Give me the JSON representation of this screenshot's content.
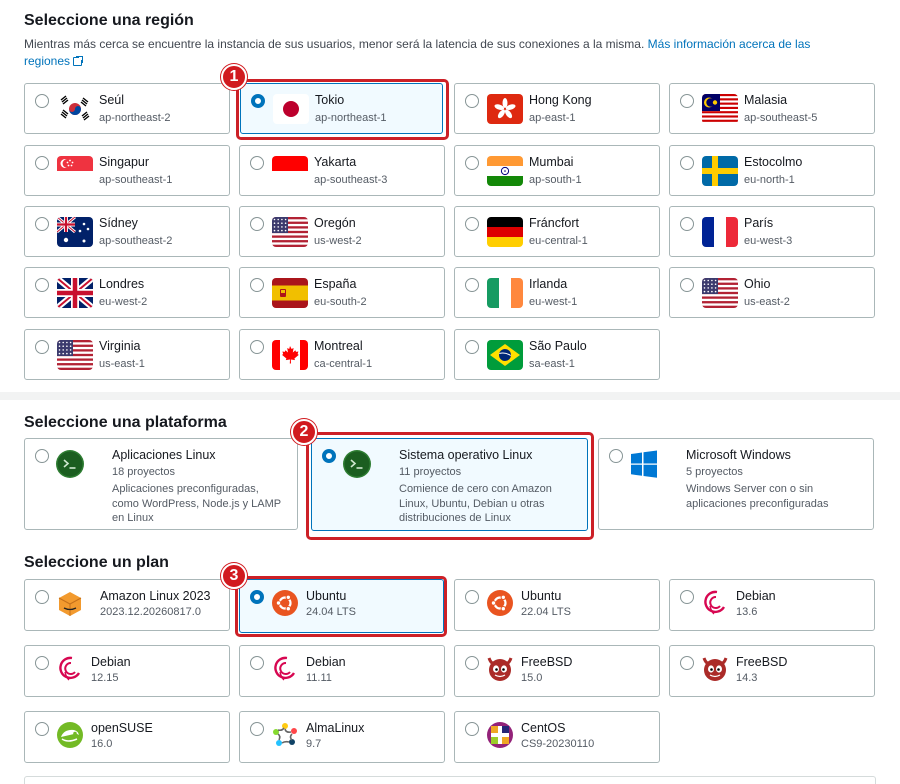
{
  "region_section": {
    "title": "Seleccione una región",
    "description": "Mientras más cerca se encuentre la instancia de sus usuarios, menor será la latencia de sus conexiones a la misma.",
    "link": "Más información acerca de las regiones",
    "regions": [
      {
        "name": "Seúl",
        "code": "ap-northeast-2",
        "flag": "south-korea-flag",
        "selected": false
      },
      {
        "name": "Tokio",
        "code": "ap-northeast-1",
        "flag": "japan-flag",
        "selected": true
      },
      {
        "name": "Hong Kong",
        "code": "ap-east-1",
        "flag": "hong-kong-flag",
        "selected": false
      },
      {
        "name": "Malasia",
        "code": "ap-southeast-5",
        "flag": "malaysia-flag",
        "selected": false
      },
      {
        "name": "Singapur",
        "code": "ap-southeast-1",
        "flag": "singapore-flag",
        "selected": false
      },
      {
        "name": "Yakarta",
        "code": "ap-southeast-3",
        "flag": "indonesia-flag",
        "selected": false
      },
      {
        "name": "Mumbai",
        "code": "ap-south-1",
        "flag": "india-flag",
        "selected": false
      },
      {
        "name": "Estocolmo",
        "code": "eu-north-1",
        "flag": "sweden-flag",
        "selected": false
      },
      {
        "name": "Sídney",
        "code": "ap-southeast-2",
        "flag": "australia-flag",
        "selected": false
      },
      {
        "name": "Oregón",
        "code": "us-west-2",
        "flag": "usa-flag",
        "selected": false
      },
      {
        "name": "Fráncfort",
        "code": "eu-central-1",
        "flag": "germany-flag",
        "selected": false
      },
      {
        "name": "París",
        "code": "eu-west-3",
        "flag": "france-flag",
        "selected": false
      },
      {
        "name": "Londres",
        "code": "eu-west-2",
        "flag": "uk-flag",
        "selected": false
      },
      {
        "name": "España",
        "code": "eu-south-2",
        "flag": "spain-flag",
        "selected": false
      },
      {
        "name": "Irlanda",
        "code": "eu-west-1",
        "flag": "ireland-flag",
        "selected": false
      },
      {
        "name": "Ohio",
        "code": "us-east-2",
        "flag": "usa-flag",
        "selected": false
      },
      {
        "name": "Virginia",
        "code": "us-east-1",
        "flag": "usa-flag",
        "selected": false
      },
      {
        "name": "Montreal",
        "code": "ca-central-1",
        "flag": "canada-flag",
        "selected": false
      },
      {
        "name": "São Paulo",
        "code": "sa-east-1",
        "flag": "brazil-flag",
        "selected": false
      }
    ]
  },
  "platform_section": {
    "title": "Seleccione una plataforma",
    "platforms": [
      {
        "name": "Aplicaciones Linux",
        "count": "18 proyectos",
        "description": "Aplicaciones preconfiguradas, como WordPress, Node.js y LAMP en Linux",
        "icon": "terminal-icon",
        "selected": false
      },
      {
        "name": "Sistema operativo Linux",
        "count": "11 proyectos",
        "description": "Comience de cero con Amazon Linux, Ubuntu, Debian u otras distribuciones de Linux",
        "icon": "terminal-icon",
        "selected": true
      },
      {
        "name": "Microsoft Windows",
        "count": "5 proyectos",
        "description": "Windows Server con o sin aplicaciones preconfiguradas",
        "icon": "windows-icon",
        "selected": false
      }
    ]
  },
  "plan_section": {
    "title": "Seleccione un plan",
    "plans": [
      {
        "name": "Amazon Linux 2023",
        "version": "2023.12.20260817.0",
        "icon": "amazon-linux-icon",
        "selected": false
      },
      {
        "name": "Ubuntu",
        "version": "24.04 LTS",
        "icon": "ubuntu-icon",
        "selected": true
      },
      {
        "name": "Ubuntu",
        "version": "22.04 LTS",
        "icon": "ubuntu-icon",
        "selected": false
      },
      {
        "name": "Debian",
        "version": "13.6",
        "icon": "debian-icon",
        "selected": false
      },
      {
        "name": "Debian",
        "version": "12.15",
        "icon": "debian-icon",
        "selected": false
      },
      {
        "name": "Debian",
        "version": "11.11",
        "icon": "debian-icon",
        "selected": false
      },
      {
        "name": "FreeBSD",
        "version": "15.0",
        "icon": "freebsd-icon",
        "selected": false
      },
      {
        "name": "FreeBSD",
        "version": "14.3",
        "icon": "freebsd-icon",
        "selected": false
      },
      {
        "name": "openSUSE",
        "version": "16.0",
        "icon": "opensuse-icon",
        "selected": false
      },
      {
        "name": "AlmaLinux",
        "version": "9.7",
        "icon": "almalinux-icon",
        "selected": false
      },
      {
        "name": "CentOS",
        "version": "CS9-20230110",
        "icon": "centos-icon",
        "selected": false
      }
    ]
  },
  "annotations": [
    {
      "label": "1"
    },
    {
      "label": "2"
    },
    {
      "label": "3"
    }
  ],
  "colors": {
    "accent": "#0073bb",
    "highlight": "#cc2027",
    "selected_bg": "#f1faff"
  }
}
